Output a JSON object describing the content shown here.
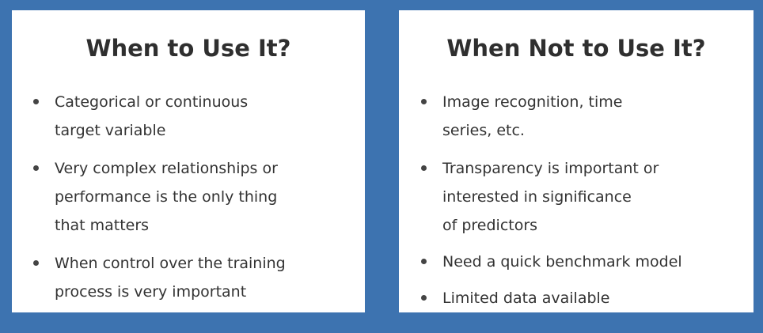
{
  "left_panel": {
    "title": "When to Use It?",
    "items": [
      {
        "lines": [
          "Categorical or continuous",
          "target variable"
        ]
      },
      {
        "lines": [
          "Very complex relationships or",
          "performance is the only thing",
          "that matters"
        ]
      },
      {
        "lines": [
          "When control over the training",
          "process is very important"
        ]
      }
    ]
  },
  "right_panel": {
    "title": "When Not to Use It?",
    "items": [
      {
        "lines": [
          "Image recognition, time",
          "series, etc."
        ]
      },
      {
        "lines": [
          "Transparency is important or",
          "interested in significance",
          "of predictors"
        ]
      },
      {
        "lines": [
          "Need a quick benchmark model"
        ]
      },
      {
        "lines": [
          "Limited data available"
        ]
      }
    ]
  },
  "colors": {
    "background": "#3d73b0",
    "panel": "#ffffff",
    "title_text": "#2f2f2f",
    "body_text": "#333333"
  }
}
